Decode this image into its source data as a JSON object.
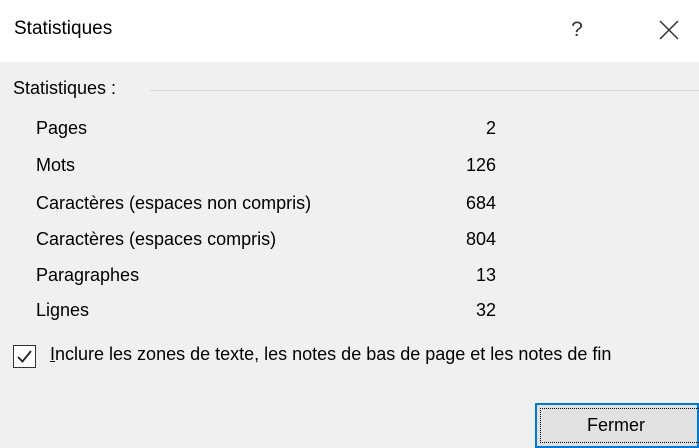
{
  "window": {
    "title": "Statistiques",
    "help_glyph": "?",
    "close_icon": "close-icon"
  },
  "group": {
    "label": "Statistiques :"
  },
  "stats": [
    {
      "label": "Pages",
      "value": "2"
    },
    {
      "label": "Mots",
      "value": "126"
    },
    {
      "label": "Caractères (espaces non compris)",
      "value": "684"
    },
    {
      "label": "Caractères (espaces compris)",
      "value": "804"
    },
    {
      "label": "Paragraphes",
      "value": "13"
    },
    {
      "label": "Lignes",
      "value": "32"
    }
  ],
  "include_checkbox": {
    "checked": true,
    "label_mnemonic": "I",
    "label_rest": "nclure les zones de texte, les notes de bas de page et les notes de fin"
  },
  "buttons": {
    "close_label": "Fermer"
  },
  "colors": {
    "titlebar_bg": "#ffffff",
    "body_bg": "#f0f0f0",
    "focus_border": "#0078d7"
  }
}
